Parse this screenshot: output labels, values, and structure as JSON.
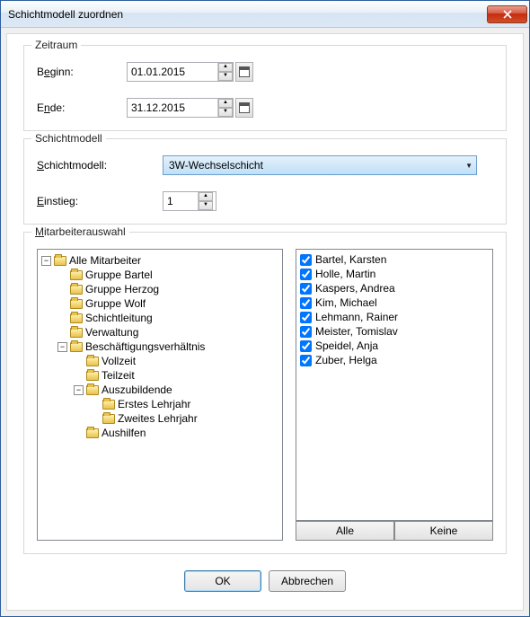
{
  "window": {
    "title": "Schichtmodell zuordnen"
  },
  "period": {
    "legend": "Zeitraum",
    "begin_prefix": "B",
    "begin_ul": "e",
    "begin_suffix": "ginn:",
    "end_prefix": "E",
    "end_ul": "n",
    "end_suffix": "de:",
    "begin_value": "01.01.2015",
    "end_value": "31.12.2015"
  },
  "model": {
    "legend": "Schichtmodell",
    "model_prefix": "",
    "model_ul": "S",
    "model_suffix": "chichtmodell:",
    "selected": "3W-Wechselschicht",
    "entry_prefix": "",
    "entry_ul": "E",
    "entry_suffix": "instieg:",
    "entry_value": "1"
  },
  "employees": {
    "legend_ul": "M",
    "legend_suffix": "itarbeiterauswahl",
    "all_btn": "Alle",
    "none_btn": "Keine",
    "tree": {
      "root": "Alle Mitarbeiter",
      "groups": [
        "Gruppe Bartel",
        "Gruppe Herzog",
        "Gruppe Wolf",
        "Schichtleitung",
        "Verwaltung"
      ],
      "emp_rel": "Beschäftigungsverhältnis",
      "vollzeit": "Vollzeit",
      "teilzeit": "Teilzeit",
      "azubi": "Auszubildende",
      "lj1": "Erstes Lehrjahr",
      "lj2": "Zweites Lehrjahr",
      "aushilfen": "Aushilfen"
    },
    "list": [
      {
        "name": "Bartel, Karsten",
        "checked": true
      },
      {
        "name": "Holle, Martin",
        "checked": true
      },
      {
        "name": "Kaspers, Andrea",
        "checked": true
      },
      {
        "name": "Kim, Michael",
        "checked": true
      },
      {
        "name": "Lehmann, Rainer",
        "checked": true
      },
      {
        "name": "Meister, Tomislav",
        "checked": true
      },
      {
        "name": "Speidel, Anja",
        "checked": true
      },
      {
        "name": "Zuber, Helga",
        "checked": true
      }
    ]
  },
  "footer": {
    "ok": "OK",
    "cancel": "Abbrechen"
  }
}
